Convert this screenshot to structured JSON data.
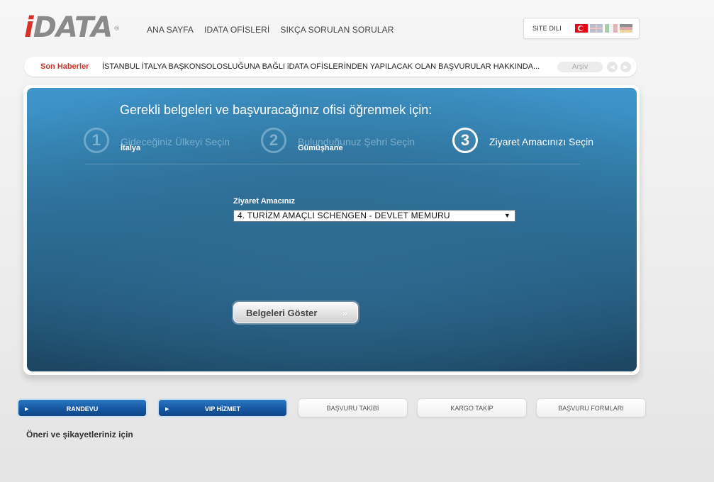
{
  "brand": {
    "logo_text": "DATA",
    "logo_i": "i",
    "reg_mark": "®",
    "accent_color": "#d9302c"
  },
  "nav": {
    "items": [
      {
        "label": "ANA SAYFA"
      },
      {
        "label": "iDATA OFİSLERİ"
      },
      {
        "label": "SIKÇA SORULAN SORULAR"
      }
    ]
  },
  "language": {
    "label": "SITE DILI",
    "flags": [
      "turkey-flag-icon",
      "uk-flag-icon",
      "italy-flag-icon",
      "germany-flag-icon"
    ]
  },
  "news": {
    "label": "Son Haberler",
    "text": "İSTANBUL İTALYA BAŞKONSOLOSLUĞUNA BAĞLI iDATA OFİSLERİNDEN YAPILACAK OLAN BAŞVURULAR HAKKINDA...",
    "archive_label": "Arşiv",
    "prev_icon": "◀",
    "next_icon": "▶"
  },
  "wizard": {
    "title": "Gerekli belgeleri ve başvuracağınız ofisi öğrenmek için:",
    "steps": [
      {
        "number": "1",
        "label": "Gideceğiniz Ülkeyi Seçin",
        "value": "İtalya",
        "active": false
      },
      {
        "number": "2",
        "label": "Bulunduğunuz Şehri Seçin",
        "value": "Gümüşhane",
        "active": false
      },
      {
        "number": "3",
        "label": "Ziyaret Amacınızı Seçin",
        "value": "",
        "active": true
      }
    ],
    "purpose_label": "Ziyaret Amacınız",
    "purpose_selected": "4. TURİZM AMAÇLI SCHENGEN - DEVLET MEMURU",
    "select_arrow": "▼",
    "submit_label": "Belgeleri Göster",
    "submit_arrow": "»"
  },
  "bottom_buttons": [
    {
      "label": "RANDEVU",
      "style": "blue",
      "arrow": "▶"
    },
    {
      "label": "VIP HİZMET",
      "style": "blue",
      "arrow": "▶"
    },
    {
      "label": "BAŞVURU TAKİBİ",
      "style": "gray"
    },
    {
      "label": "KARGO TAKİP",
      "style": "gray"
    },
    {
      "label": "BAŞVURU FORMLARI",
      "style": "gray"
    }
  ],
  "feedback_text": "Öneri ve şikayetleriniz için"
}
